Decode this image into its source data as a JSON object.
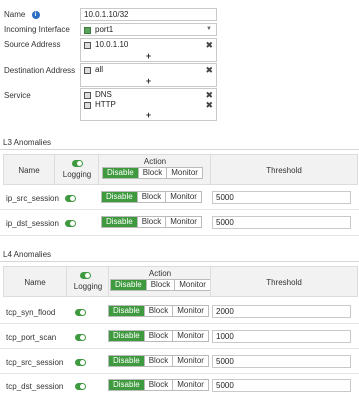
{
  "form": {
    "name_label": "Name",
    "name_value": "10.0.1.10/32",
    "incoming_label": "Incoming Interface",
    "incoming_value": "port1",
    "source_label": "Source Address",
    "source_value": "10.0.1.10",
    "destination_label": "Destination Address",
    "destination_value": "all",
    "service_label": "Service",
    "service_values": [
      "DNS",
      "HTTP"
    ],
    "add_symbol": "+",
    "remove_symbol": "✖"
  },
  "columns": {
    "name": "Name",
    "logging": "Logging",
    "action": "Action",
    "threshold": "Threshold",
    "buttons": [
      "Disable",
      "Block",
      "Monitor"
    ]
  },
  "l3": {
    "title": "L3 Anomalies",
    "rows": [
      {
        "name": "ip_src_session",
        "threshold": "5000",
        "action": "Disable",
        "logging": true
      },
      {
        "name": "ip_dst_session",
        "threshold": "5000",
        "action": "Disable",
        "logging": true
      }
    ]
  },
  "l4": {
    "title": "L4 Anomalies",
    "rows": [
      {
        "name": "tcp_syn_flood",
        "threshold": "2000",
        "action": "Disable",
        "logging": true
      },
      {
        "name": "tcp_port_scan",
        "threshold": "1000",
        "action": "Disable",
        "logging": true
      },
      {
        "name": "tcp_src_session",
        "threshold": "5000",
        "action": "Disable",
        "logging": true
      },
      {
        "name": "tcp_dst_session",
        "threshold": "5000",
        "action": "Disable",
        "logging": true
      }
    ]
  },
  "colors": {
    "accent_green": "#3f9a3f",
    "info_blue": "#2d6fc0"
  },
  "icons": [
    "info-icon",
    "port-icon",
    "address-icon",
    "service-icon",
    "remove-icon",
    "add-icon",
    "toggle-on-icon"
  ]
}
